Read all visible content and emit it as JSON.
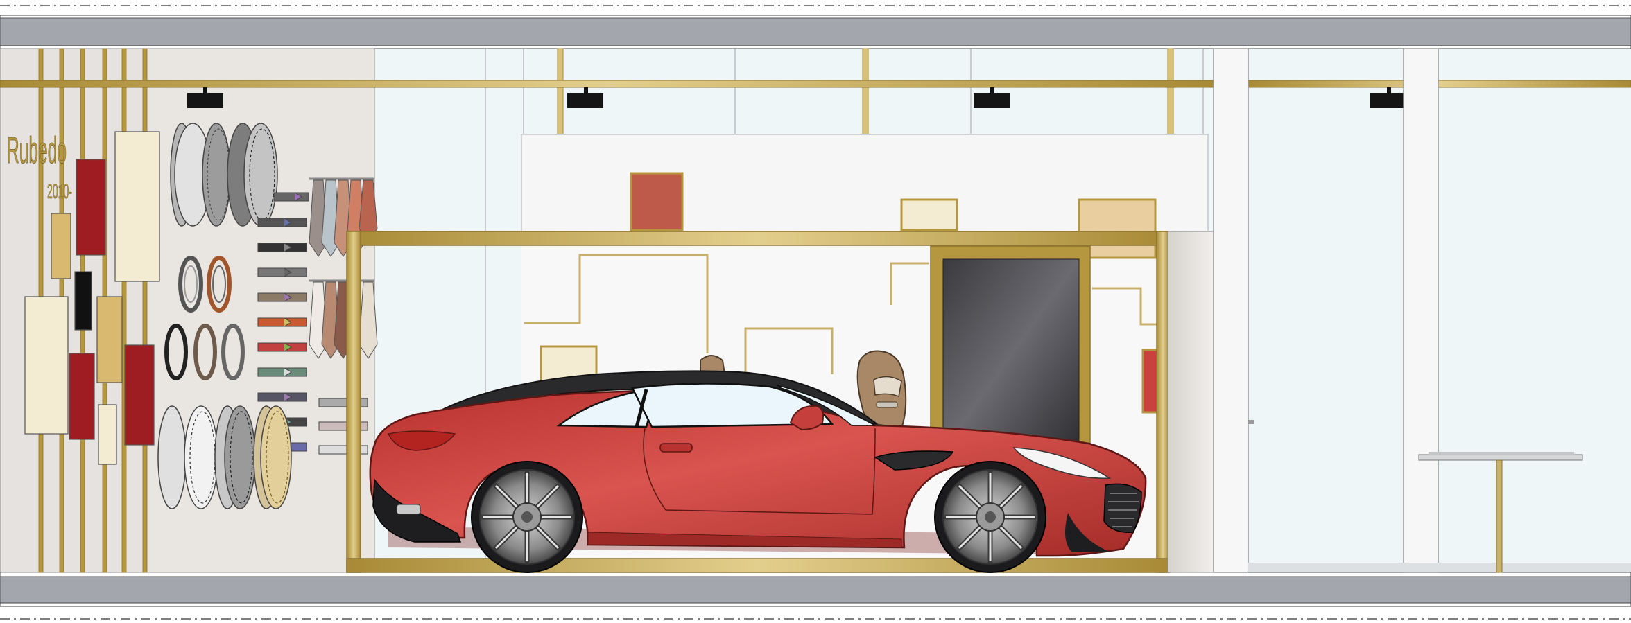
{
  "brand": {
    "name": "Rubedo",
    "year": "2010-"
  },
  "colors": {
    "beam": "#a3a7ad",
    "gold": "#b5973f",
    "gold_light": "#d8c27a",
    "wall": "#e6e2df",
    "glass": "#eef6f8",
    "car_red": "#c9423f",
    "car_red_dark": "#9e2a27",
    "swatch_red": "#9d1d22",
    "swatch_gold": "#d9b870",
    "swatch_cream": "#f3ecd2"
  },
  "icons": {
    "spotlights": [
      "spotlight-icon",
      "spotlight-icon",
      "spotlight-icon",
      "spotlight-icon"
    ],
    "wheels": [
      "alloy-wheel-icon"
    ],
    "steering_wheels": [
      "steering-wheel-icon"
    ],
    "car": "sports-car-icon",
    "seat": "car-seat-icon"
  }
}
